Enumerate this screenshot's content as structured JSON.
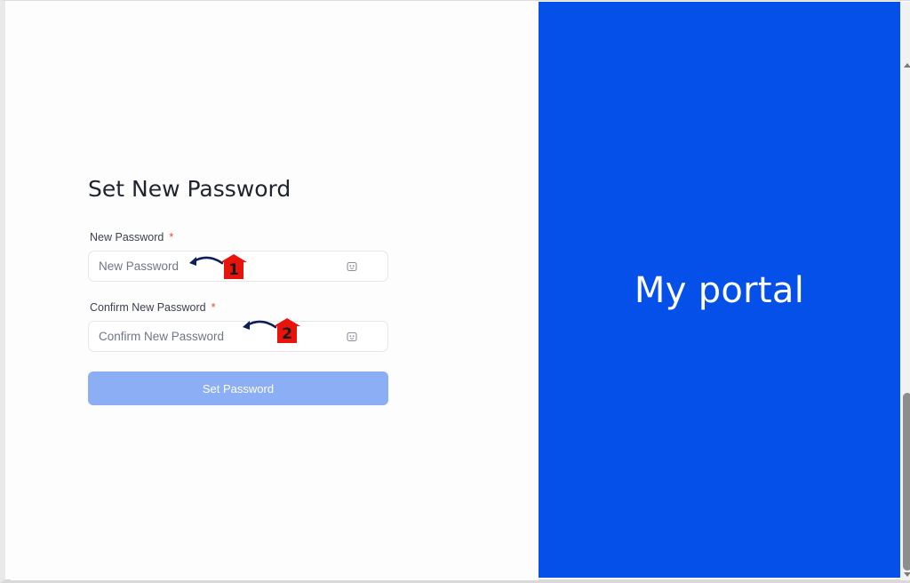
{
  "form": {
    "title": "Set New Password",
    "new_password": {
      "label": "New Password",
      "required_mark": "*",
      "placeholder": "New Password",
      "value": ""
    },
    "confirm_password": {
      "label": "Confirm New Password",
      "required_mark": "*",
      "placeholder": "Confirm New Password",
      "value": ""
    },
    "submit_label": "Set Password"
  },
  "brand_panel": {
    "text": "My portal",
    "background": "#0450e8",
    "text_color": "#ffffff"
  },
  "annotations": [
    {
      "number": "1",
      "badge_color": "#e8140c",
      "arrow_color": "#0e1e5c"
    },
    {
      "number": "2",
      "badge_color": "#e8140c",
      "arrow_color": "#0e1e5c"
    }
  ],
  "colors": {
    "button_disabled": "#8baef4",
    "required_asterisk": "#e5483a",
    "title_text": "#1f2430"
  },
  "icons": {
    "password_toggle": "eye-toggle-icon",
    "annotation_arrow": "curved-arrow-icon"
  }
}
